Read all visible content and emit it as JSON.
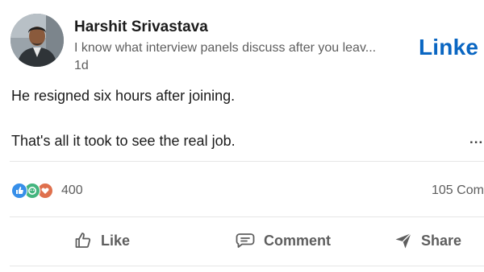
{
  "author": {
    "name": "Harshit Srivastava",
    "headline": "I know what interview panels discuss after you leav...",
    "age": "1d"
  },
  "brand": {
    "logo_text": "Linke",
    "color": "#0a66c2"
  },
  "post": {
    "line1": "He resigned six hours after joining.",
    "line2": "That's all it took to see the real job.",
    "more_label": "..."
  },
  "stats": {
    "reaction_icons": [
      "like-icon",
      "celebrate-icon",
      "love-icon"
    ],
    "reaction_count": "400",
    "comments": "105 Com"
  },
  "actions": {
    "like": "Like",
    "comment": "Comment",
    "share": "Share"
  },
  "colors": {
    "text_primary": "#1b1b1b",
    "text_secondary": "#5e5e5e",
    "like_blue": "#378fe9",
    "celebrate_green": "#44b57f",
    "love_pink": "#df704d"
  }
}
